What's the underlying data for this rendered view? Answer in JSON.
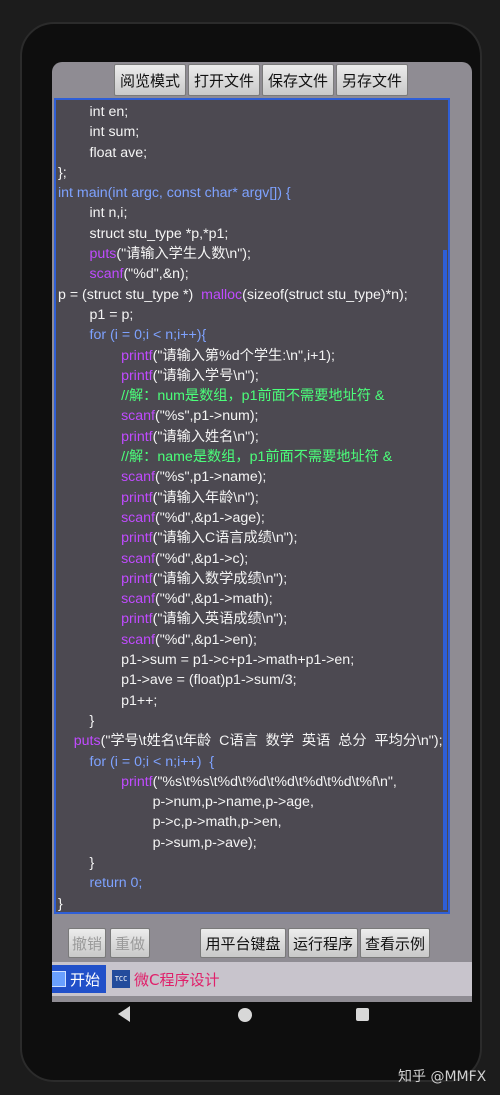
{
  "toolbar": {
    "browse_mode": "阅览模式",
    "open_file": "打开文件",
    "save_file": "保存文件",
    "save_as": "另存文件"
  },
  "bottom_buttons": {
    "undo": "撤销",
    "redo": "重做",
    "platform_keyboard": "用平台键盘",
    "run_program": "运行程序",
    "view_examples": "查看示例"
  },
  "taskbar": {
    "start_label": "开始",
    "task_icon_text": "TCC",
    "task_label": "微C程序设计"
  },
  "watermark": "知乎 @MMFX",
  "code": {
    "l1": "        int en;",
    "l2": "        int sum;",
    "l3": "        float ave;",
    "l4": "};",
    "l5a": "int main(int argc, const char* argv[]) {",
    "l6": "        int n,i;",
    "l7": "        struct stu_type *p,*p1;",
    "l8a": "        puts",
    "l8b": "(\"请输入学生人数\\n\");",
    "l9a": "        scanf",
    "l9b": "(\"%d\",&n);",
    "l10a": "p = (struct stu_type *)  ",
    "l10b": "malloc",
    "l10c": "(sizeof(struct stu_type)*n);",
    "l11": "        p1 = p;",
    "l12": "        for (i = 0;i < n;i++){",
    "l13a": "                printf",
    "l13b": "(\"请输入第%d个学生:\\n\",i+1);",
    "l14a": "                printf",
    "l14b": "(\"请输入学号\\n\");",
    "l15": "                //解：num是数组，p1前面不需要地址符 &",
    "l16a": "                scanf",
    "l16b": "(\"%s\",p1->num);",
    "l17a": "                printf",
    "l17b": "(\"请输入姓名\\n\");",
    "l18": "                //解：name是数组，p1前面不需要地址符 &",
    "l19a": "                scanf",
    "l19b": "(\"%s\",p1->name);",
    "l20a": "                printf",
    "l20b": "(\"请输入年龄\\n\");",
    "l21a": "                scanf",
    "l21b": "(\"%d\",&p1->age);",
    "l22a": "                printf",
    "l22b": "(\"请输入C语言成绩\\n\");",
    "l23a": "                scanf",
    "l23b": "(\"%d\",&p1->c);",
    "l24a": "                printf",
    "l24b": "(\"请输入数学成绩\\n\");",
    "l25a": "                scanf",
    "l25b": "(\"%d\",&p1->math);",
    "l26a": "                printf",
    "l26b": "(\"请输入英语成绩\\n\");",
    "l27a": "                scanf",
    "l27b": "(\"%d\",&p1->en);",
    "l28": "                p1->sum = p1->c+p1->math+p1->en;",
    "l29": "                p1->ave = (float)p1->sum/3;",
    "l30": "                p1++;",
    "l31": "        }",
    "l32a": "    puts",
    "l32b": "(\"学号\\t姓名\\t年龄  C语言  数学  英语  总分  平均分\\n\");",
    "l33": "        for (i = 0;i < n;i++)  {",
    "l34a": "                printf",
    "l34b": "(\"%s\\t%s\\t%d\\t%d\\t%d\\t%d\\t%d\\t%f\\n\",",
    "l35": "                        p->num,p->name,p->age,",
    "l36": "                        p->c,p->math,p->en,",
    "l37": "                        p->sum,p->ave);",
    "l38": "        }",
    "l39": "        return 0;",
    "l40": "}"
  }
}
